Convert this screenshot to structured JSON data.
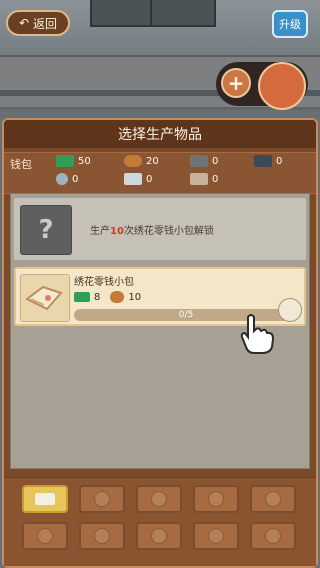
{
  "header": {
    "back_label": "返回",
    "upgrade_label": "升级"
  },
  "dialog": {
    "title": "选择生产物品"
  },
  "wallet": {
    "label": "钱包",
    "resources": [
      {
        "icon": "cash-stack-icon",
        "value": "50"
      },
      {
        "icon": "coin-icon",
        "value": "0"
      },
      {
        "icon": "yarn-ball-icon",
        "value": "20"
      },
      {
        "icon": "scissors-icon",
        "value": "0"
      },
      {
        "icon": "metal-bar-icon",
        "value": "0"
      },
      {
        "icon": "thimble-icon",
        "value": "0"
      },
      {
        "icon": "cloth-roll-icon",
        "value": "0"
      },
      {
        "icon": "sewing-machine-icon",
        "value": "0"
      }
    ]
  },
  "locked_item": {
    "text_before": "生产",
    "text_count": "10",
    "text_after": "次绣花零钱小包解锁"
  },
  "item": {
    "name": "绣花零钱小包",
    "cost_cash": "8",
    "cost_yarn": "10",
    "progress_label": "0/5",
    "progress_fraction": 0.0
  }
}
